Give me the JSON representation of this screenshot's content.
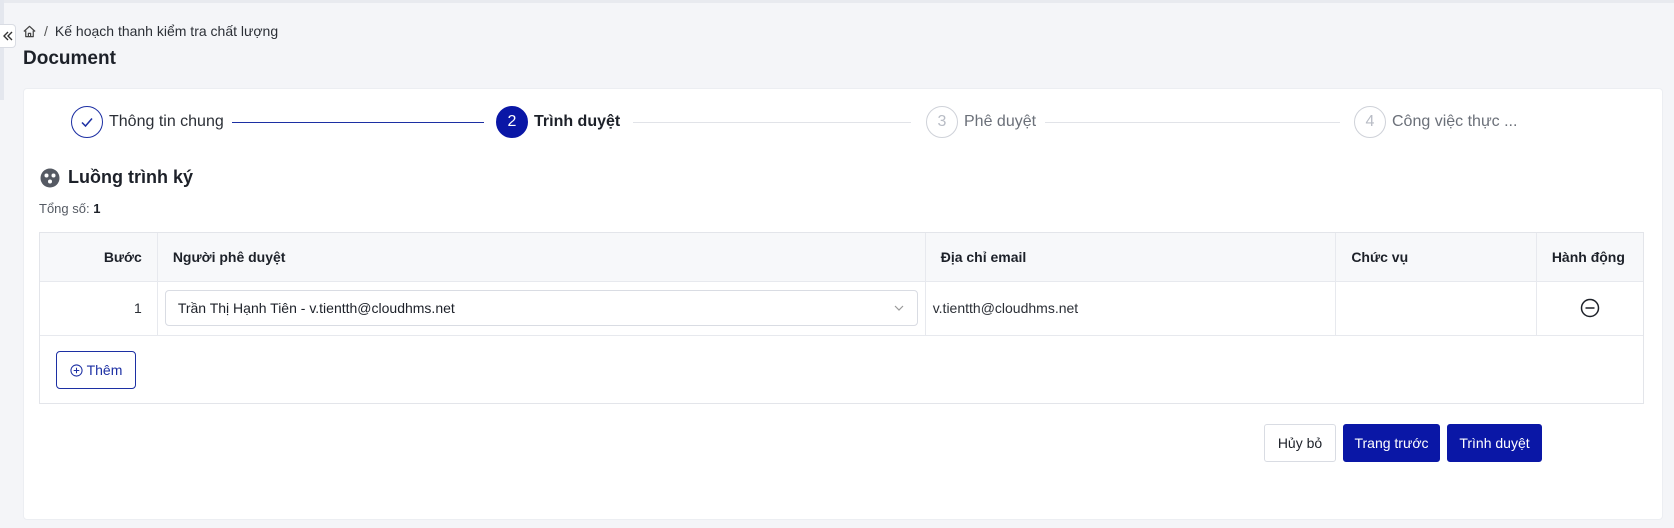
{
  "breadcrumb": {
    "home_icon": "home-icon",
    "separator": "/",
    "current": "Kế hoạch thanh kiểm tra chất lượng"
  },
  "page": {
    "title": "Document"
  },
  "steps": [
    {
      "number": "1",
      "label": "Thông tin chung",
      "status": "done"
    },
    {
      "number": "2",
      "label": "Trình duyệt",
      "status": "active"
    },
    {
      "number": "3",
      "label": "Phê duyệt",
      "status": "pending"
    },
    {
      "number": "4",
      "label": "Công việc thực ...",
      "status": "pending"
    }
  ],
  "section": {
    "title": "Luồng trình ký",
    "icon": "flow-icon",
    "total_label": "Tổng số:",
    "total_value": "1"
  },
  "table": {
    "headers": {
      "step": "Bước",
      "approver": "Người phê duyệt",
      "email": "Địa chỉ email",
      "position": "Chức vụ",
      "action": "Hành động"
    },
    "rows": [
      {
        "step": "1",
        "approver": "Trần Thị Hạnh Tiên - v.tientth@cloudhms.net",
        "email": "v.tientth@cloudhms.net",
        "position": ""
      }
    ],
    "add_label": "Thêm"
  },
  "footer": {
    "cancel": "Hủy bỏ",
    "previous": "Trang trước",
    "submit": "Trình duyệt"
  },
  "colors": {
    "primary": "#0a17a6",
    "border": "#d9dce3",
    "muted": "#b8bcc5"
  }
}
